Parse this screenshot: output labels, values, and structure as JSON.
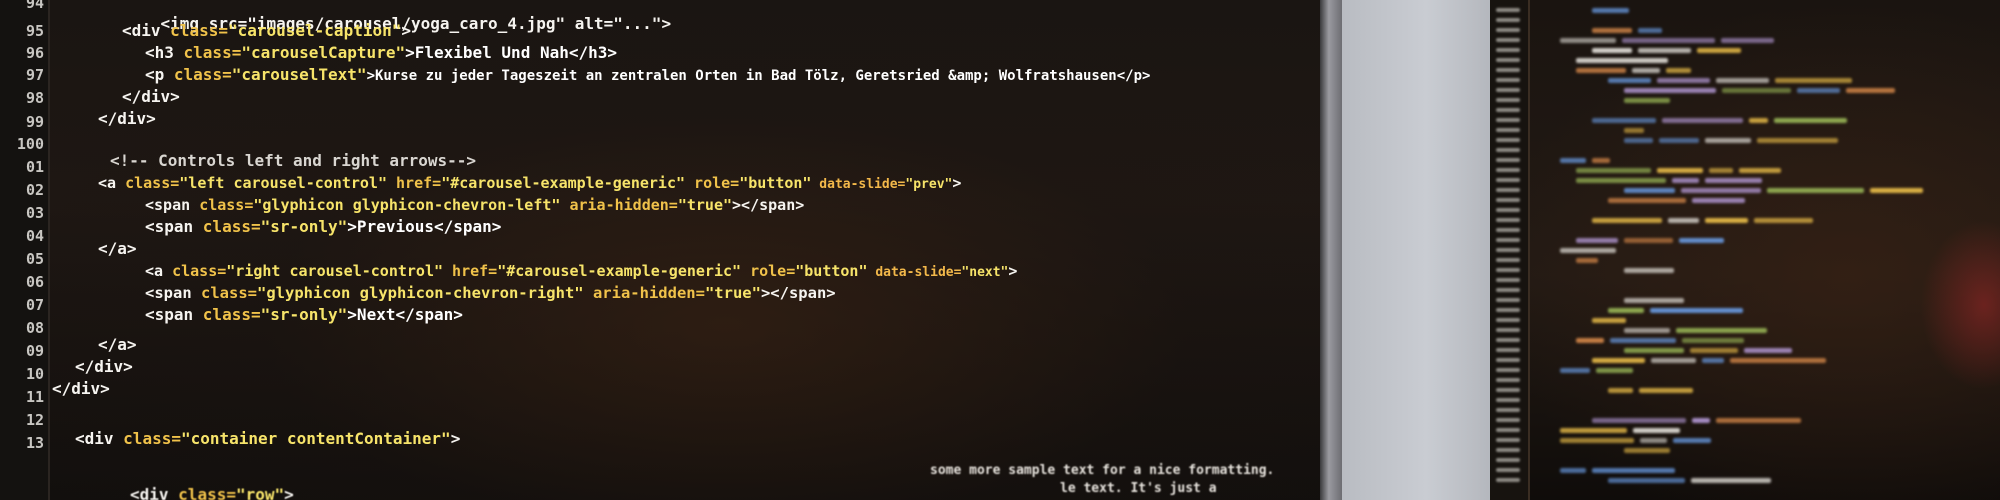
{
  "editor": {
    "line_numbers": [
      "94",
      "95",
      "96",
      "97",
      "98",
      "99",
      "100",
      "01",
      "02",
      "03",
      "04",
      "05",
      "06",
      "07",
      "08",
      "09",
      "10",
      "11",
      "12",
      "13"
    ],
    "code": {
      "l94": [
        "<img src=\"images/carousel/yoga_caro_4.jpg\" alt=\"...\">"
      ],
      "l95_tag_open": "<div ",
      "l95_attr": "class=",
      "l95_val": "\"carousel-caption\"",
      "l95_close": ">",
      "l96_open": "<h3 ",
      "l96_attr": "class=",
      "l96_val": "\"carouselCapture\"",
      "l96_text": ">Flexibel Und Nah</h3>",
      "l97_open": "<p ",
      "l97_attr": "class=",
      "l97_val": "\"carouselText\"",
      "l97_text": ">Kurse zu jeder Tageszeit an zentralen Orten in Bad Tölz, Geretsried &amp; Wolfratshausen</p>",
      "l98": "</div>",
      "l99": "</div>",
      "l101_comment": "<!-- Controls left and right arrows-->",
      "l102_open": "<a ",
      "l102_attr1": "class=",
      "l102_val1": "\"left carousel-control\"",
      "l102_attr2": " href=",
      "l102_val2": "\"#carousel-example-generic\"",
      "l102_attr3": " role=",
      "l102_val3": "\"button\"",
      "l102_attr4": " data-slide=",
      "l102_val4": "\"prev\"",
      "l102_close": ">",
      "l103_open": "<span ",
      "l103_attr1": "class=",
      "l103_val1": "\"glyphicon glyphicon-chevron-left\"",
      "l103_attr2": " aria-hidden=",
      "l103_val2": "\"true\"",
      "l103_close": "></span>",
      "l104_open": "<span ",
      "l104_attr": "class=",
      "l104_val": "\"sr-only\"",
      "l104_text": ">Previous</span>",
      "l105": "</a>",
      "l106_open": "<a ",
      "l106_attr1": "class=",
      "l106_val1": "\"right carousel-control\"",
      "l106_attr2": " href=",
      "l106_val2": "\"#carousel-example-generic\"",
      "l106_attr3": " role=",
      "l106_val3": "\"button\"",
      "l106_attr4": " data-slide=",
      "l106_val4": "\"next\"",
      "l106_close": ">",
      "l107_open": "<span ",
      "l107_attr1": "class=",
      "l107_val1": "\"glyphicon glyphicon-chevron-right\"",
      "l107_attr2": " aria-hidden=",
      "l107_val2": "\"true\"",
      "l107_close": "></span>",
      "l108_open": "<span ",
      "l108_attr": "class=",
      "l108_val": "\"sr-only\"",
      "l108_text": ">Next</span>",
      "l109": "</a>",
      "l110": "</div>",
      "l111": "</div>",
      "l113_open": "<div ",
      "l113_attr": "class=",
      "l113_val": "\"container contentContainer\"",
      "l113_close": ">",
      "l115_open": "<div ",
      "l115_attr": "class=",
      "l115_val": "\"row\"",
      "l115_close": ">",
      "bottom_text_1": "some more sample text for a nice formatting.",
      "bottom_text_2": "le text. It's just a"
    }
  },
  "colors": {
    "tag": "#f6f4f0",
    "keyword": "#f0c24a",
    "string": "#f7e46a",
    "background": "#1a1512"
  }
}
